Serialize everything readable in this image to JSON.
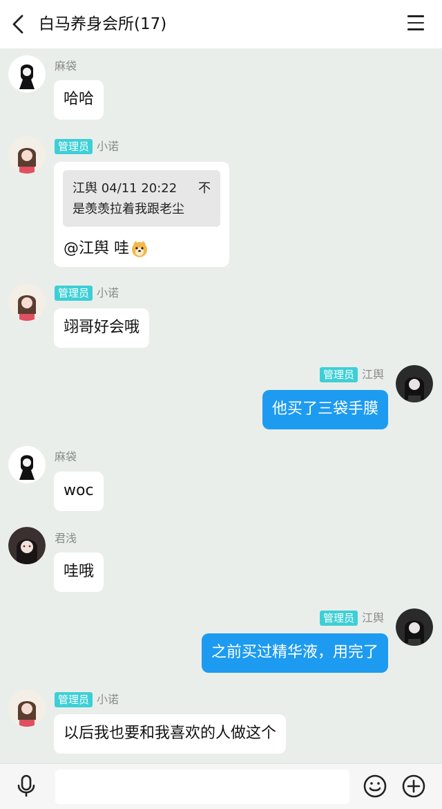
{
  "header": {
    "title": "白马养身会所(17)"
  },
  "messages": [
    {
      "sender": "麻袋",
      "text": "哈哈"
    },
    {
      "sender": "小诺",
      "badge": "管理员",
      "quote": {
        "author_time": "江舆 04/11 20:22",
        "line2": "是羡羡拉着我跟老尘",
        "end_char": "不"
      },
      "text": "@江舆 哇"
    },
    {
      "sender": "小诺",
      "badge": "管理员",
      "text": "翊哥好会哦"
    },
    {
      "sender": "江舆",
      "badge": "管理员",
      "text": "他买了三袋手膜",
      "self": true
    },
    {
      "sender": "麻袋",
      "text": "woc"
    },
    {
      "sender": "君浅",
      "text": "哇哦"
    },
    {
      "sender": "江舆",
      "badge": "管理员",
      "text": "之前买过精华液，用完了",
      "self": true
    },
    {
      "sender": "小诺",
      "badge": "管理员",
      "text": "以后我也要和我喜欢的人做这个"
    }
  ],
  "footer": {
    "input_value": ""
  },
  "icons": [
    "back-arrow-icon",
    "menu-icon",
    "doge-emoji-icon",
    "microphone-icon",
    "emoji-icon",
    "add-icon"
  ],
  "colors": {
    "accent_bubble": "#1d9bf0",
    "badge": "#3ecfd6",
    "background": "#eaeeeb"
  }
}
